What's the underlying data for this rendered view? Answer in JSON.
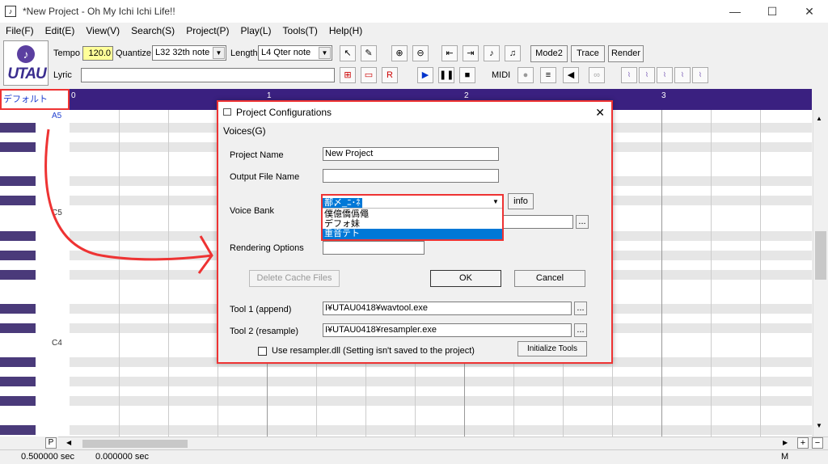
{
  "window": {
    "title": "*New Project - Oh My Ichi Ichi Life!!",
    "min": "—",
    "max": "☐",
    "close": "✕"
  },
  "menu": [
    "File(F)",
    "Edit(E)",
    "View(V)",
    "Search(S)",
    "Project(P)",
    "Play(L)",
    "Tools(T)",
    "Help(H)"
  ],
  "logo": {
    "text": "UTAU"
  },
  "toolbar": {
    "tempo_label": "Tempo",
    "tempo_value": "120.0",
    "quantize_label": "Quantize",
    "quantize_value": "L32 32th note",
    "length_label": "Length",
    "length_value": "L4  Qter note",
    "lyric_label": "Lyric",
    "lyric_value": "",
    "mode_label": "Mode2",
    "trace_label": "Trace",
    "render_label": "Render",
    "midi_label": "MIDI"
  },
  "piano": {
    "voice_label": "デフォルト",
    "ruler_marks": [
      "0",
      "1",
      "2",
      "3"
    ],
    "note_labels": [
      "A5",
      "C5",
      "C4"
    ]
  },
  "status": {
    "time1": "0.500000 sec",
    "time2": "0.000000 sec",
    "p": "P",
    "m": "M"
  },
  "dialog": {
    "title": "Project Configurations",
    "voices_label": "Voices(G)",
    "project_name_label": "Project Name",
    "project_name_value": "New Project",
    "output_file_label": "Output File Name",
    "output_file_value": "",
    "voice_bank_label": "Voice Bank",
    "voice_bank_selected": "鄯〆_ﾆ･ﾈ",
    "voice_bank_options": [
      "僕億僑僞僶",
      "デフォ妹",
      "重音テト"
    ],
    "info_label": "info",
    "rendering_label": "Rendering Options",
    "rendering_value": "",
    "delete_cache_label": "Delete Cache Files",
    "ok_label": "OK",
    "cancel_label": "Cancel",
    "tool1_label": "Tool 1 (append)",
    "tool1_value": "I¥UTAU0418¥wavtool.exe",
    "tool2_label": "Tool 2 (resample)",
    "tool2_value": "I¥UTAU0418¥resampler.exe",
    "dll_label": "Use resampler.dll (Setting isn't saved to the project)",
    "init_tools_label": "Initialize Tools",
    "browse_label": "..."
  },
  "colors": {
    "ruler": "#3a2080",
    "black_key": "#4a3a7a",
    "highlight": "#e33333",
    "select": "#0078d7"
  }
}
